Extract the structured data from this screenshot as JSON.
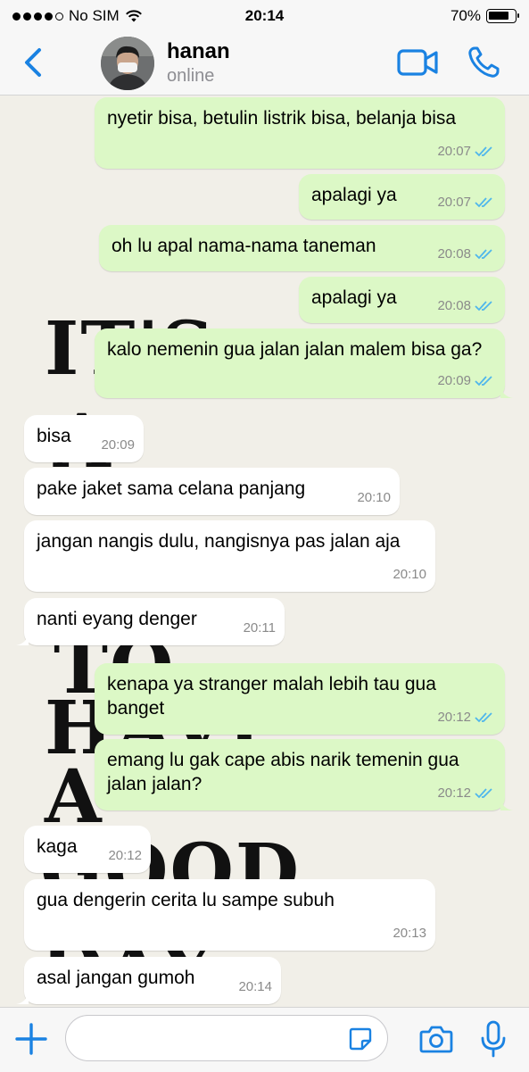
{
  "status_bar": {
    "carrier": "No SIM",
    "time": "20:14",
    "battery": "70%"
  },
  "header": {
    "name": "hanan",
    "status": "online"
  },
  "wallpaper": {
    "lines": [
      "IT'S",
      "A",
      "TO",
      "HAVE",
      "A",
      "GOOD",
      "DAY"
    ]
  },
  "messages": [
    {
      "dir": "out",
      "text": "nyetir bisa, betulin listrik bisa, belanja bisa",
      "time": "20:07"
    },
    {
      "dir": "out",
      "text": "apalagi ya",
      "time": "20:07"
    },
    {
      "dir": "out",
      "text": "oh lu apal nama-nama taneman",
      "time": "20:08"
    },
    {
      "dir": "out",
      "text": "apalagi ya",
      "time": "20:08"
    },
    {
      "dir": "out",
      "text": "kalo nemenin gua jalan jalan malem bisa ga?",
      "time": "20:09"
    },
    {
      "dir": "in",
      "text": "bisa",
      "time": "20:09"
    },
    {
      "dir": "in",
      "text": "pake jaket sama celana panjang",
      "time": "20:10"
    },
    {
      "dir": "in",
      "text": "jangan nangis dulu, nangisnya pas jalan aja",
      "time": "20:10"
    },
    {
      "dir": "in",
      "text": "nanti eyang denger",
      "time": "20:11"
    },
    {
      "dir": "out",
      "text": "kenapa ya stranger malah lebih tau gua banget",
      "time": "20:12"
    },
    {
      "dir": "out",
      "text": "emang lu gak cape abis narik temenin gua jalan jalan?",
      "time": "20:12"
    },
    {
      "dir": "in",
      "text": "kaga",
      "time": "20:12"
    },
    {
      "dir": "in",
      "text": "gua dengerin cerita lu sampe subuh",
      "time": "20:13"
    },
    {
      "dir": "in",
      "text": "asal jangan gumoh",
      "time": "20:14"
    }
  ],
  "input": {
    "placeholder": ""
  },
  "colors": {
    "accent": "#1a82e2",
    "outgoing": "#dcf8c6",
    "incoming": "#ffffff",
    "read_ticks": "#4fb6ec"
  }
}
